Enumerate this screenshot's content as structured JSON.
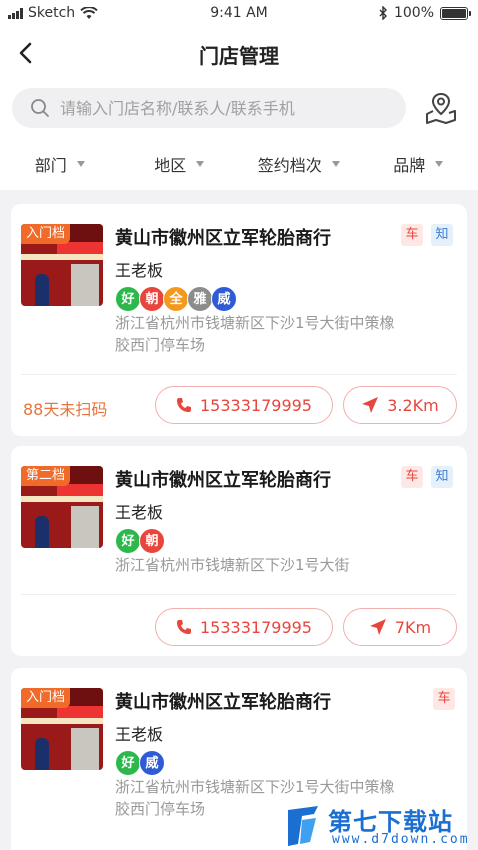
{
  "status_bar": {
    "carrier": "Sketch",
    "time": "9:41 AM",
    "battery": "100%",
    "battery_level": 1.0
  },
  "nav": {
    "title": "门店管理"
  },
  "search": {
    "placeholder": "请输入门店名称/联系人/联系手机"
  },
  "filters": [
    "部门",
    "地区",
    "签约档次",
    "品牌"
  ],
  "colors": {
    "accent": "#e8453c",
    "level_badge": "#f06a2a",
    "unscanned": "#e8743c",
    "know_tag": "#3a7ed6"
  },
  "brand_colors": {
    "好": "#2db84d",
    "朝": "#e8453c",
    "全": "#f39a1e",
    "雅": "#8c8c8c",
    "威": "#2f5bd6"
  },
  "stores": [
    {
      "level": "入门档",
      "name": "黄山市徽州区立军轮胎商行",
      "tags": [
        "车",
        "知"
      ],
      "owner": "王老板",
      "brands": [
        "好",
        "朝",
        "全",
        "雅",
        "威"
      ],
      "address": [
        "浙江省杭州市钱塘新区下沙1号大街中策橡",
        "胶西门停车场"
      ],
      "unscanned": "88天未扫码",
      "phone": "15333179995",
      "distance": "3.2Km"
    },
    {
      "level": "第二档",
      "name": "黄山市徽州区立军轮胎商行",
      "tags": [
        "车",
        "知"
      ],
      "owner": "王老板",
      "brands": [
        "好",
        "朝"
      ],
      "address": [
        "浙江省杭州市钱塘新区下沙1号大街"
      ],
      "unscanned": "",
      "phone": "15333179995",
      "distance": "7Km"
    },
    {
      "level": "入门档",
      "name": "黄山市徽州区立军轮胎商行",
      "tags": [
        "车"
      ],
      "owner": "王老板",
      "brands": [
        "好",
        "威"
      ],
      "address": [
        "浙江省杭州市钱塘新区下沙1号大街中策橡",
        "胶西门停车场"
      ]
    }
  ],
  "watermark": {
    "title": "第七下载站",
    "url": "www.d7down.com"
  }
}
